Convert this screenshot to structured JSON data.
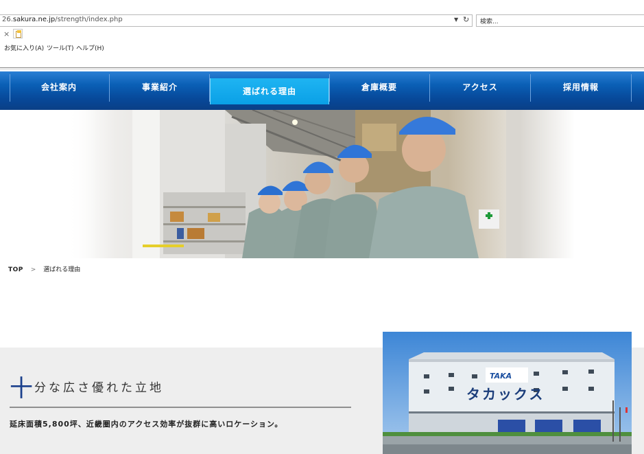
{
  "browser": {
    "url_prefix": "26.",
    "url_host": "sakura.ne.jp",
    "url_path": "/strength/index.php",
    "search_placeholder": "検索...",
    "tab_close": "×",
    "menu": [
      "お気に入り(A)",
      "ツール(T)",
      "ヘルプ(H)"
    ]
  },
  "nav": {
    "items": [
      "会社案内",
      "事業紹介",
      "選ばれる理由",
      "倉庫概要",
      "アクセス",
      "採用情報"
    ],
    "active_index": 2
  },
  "breadcrumb": {
    "top": "TOP",
    "separator": ">",
    "current": "選ばれる理由"
  },
  "section": {
    "heading_first_char": "十",
    "heading_rest": "分な広さ優れた立地",
    "subtitle": "延床面積5,800坪、近畿圏内のアクセス効率が抜群に高いロケーション。"
  },
  "building": {
    "logo_text": "TAKA",
    "sign_text": "タカックス"
  },
  "colors": {
    "nav_blue": "#0a5fb5",
    "nav_active": "#1fb4f2",
    "heading_accent": "#1a3f8c",
    "band_gray": "#eeeeee"
  }
}
